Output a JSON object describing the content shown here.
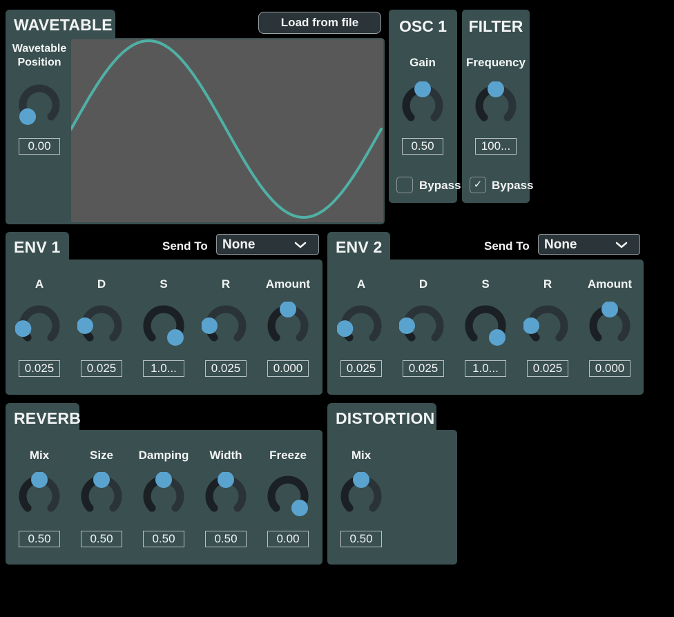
{
  "colors": {
    "panel": "#3a4f50",
    "knob_thumb": "#5ba3cf",
    "knob_track": "#2a3337",
    "knob_value": "#1a2023",
    "wave": "#4fb0a5",
    "wave_bg": "#585858"
  },
  "wavetable": {
    "title": "WAVETABLE",
    "load_button": "Load from file",
    "knob": {
      "label": "Wavetable Position",
      "value": "0.00",
      "position": 0
    }
  },
  "osc1": {
    "title": "OSC 1",
    "knob": {
      "label": "Gain",
      "value": "0.50",
      "position": 0.5
    },
    "bypass": {
      "label": "Bypass",
      "checked": false
    }
  },
  "filter": {
    "title": "FILTER",
    "knob": {
      "label": "Frequency",
      "value": "100...",
      "position": 0.5
    },
    "bypass": {
      "label": "Bypass",
      "checked": true,
      "check_glyph": "✓"
    }
  },
  "env1": {
    "title": "ENV 1",
    "send_to_label": "Send To",
    "send_to_value": "None",
    "knobs": [
      {
        "label": "A",
        "value": "0.025",
        "position": 0.13
      },
      {
        "label": "D",
        "value": "0.025",
        "position": 0.167
      },
      {
        "label": "S",
        "value": "1.0...",
        "position": 1
      },
      {
        "label": "R",
        "value": "0.025",
        "position": 0.167
      },
      {
        "label": "Amount",
        "value": "0.000",
        "position": 0.5
      }
    ]
  },
  "env2": {
    "title": "ENV 2",
    "send_to_label": "Send To",
    "send_to_value": "None",
    "knobs": [
      {
        "label": "A",
        "value": "0.025",
        "position": 0.13
      },
      {
        "label": "D",
        "value": "0.025",
        "position": 0.167
      },
      {
        "label": "S",
        "value": "1.0...",
        "position": 1
      },
      {
        "label": "R",
        "value": "0.025",
        "position": 0.167
      },
      {
        "label": "Amount",
        "value": "0.000",
        "position": 0.5
      }
    ]
  },
  "reverb": {
    "title": "REVERB",
    "knobs": [
      {
        "label": "Mix",
        "value": "0.50",
        "position": 0.5
      },
      {
        "label": "Size",
        "value": "0.50",
        "position": 0.5
      },
      {
        "label": "Damping",
        "value": "0.50",
        "position": 0.5
      },
      {
        "label": "Width",
        "value": "0.50",
        "position": 0.5
      },
      {
        "label": "Freeze",
        "value": "0.00",
        "position": 1
      }
    ]
  },
  "distortion": {
    "title": "DISTORTION",
    "knobs": [
      {
        "label": "Mix",
        "value": "0.50",
        "position": 0.5
      }
    ]
  }
}
